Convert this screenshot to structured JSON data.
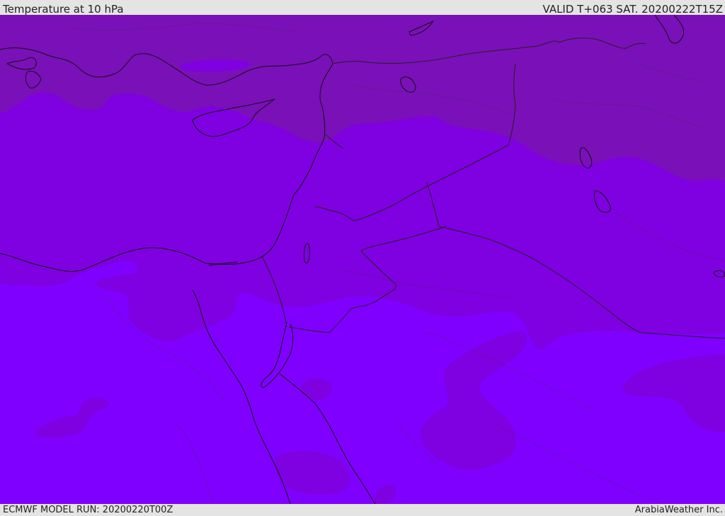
{
  "header": {
    "title": "Temperature at 10 hPa",
    "valid": "VALID T+063 SAT. 20200222T15Z"
  },
  "footer": {
    "model_run": "ECMWF MODEL RUN: 20200220T00Z",
    "provider": "ArabiaWeather Inc."
  },
  "map": {
    "colors": {
      "band_coldest": "#7a10b8",
      "band_middle": "#7f00e0",
      "band_warmest": "#7f00ff",
      "coastline": "#111111",
      "border": "#222222"
    }
  }
}
